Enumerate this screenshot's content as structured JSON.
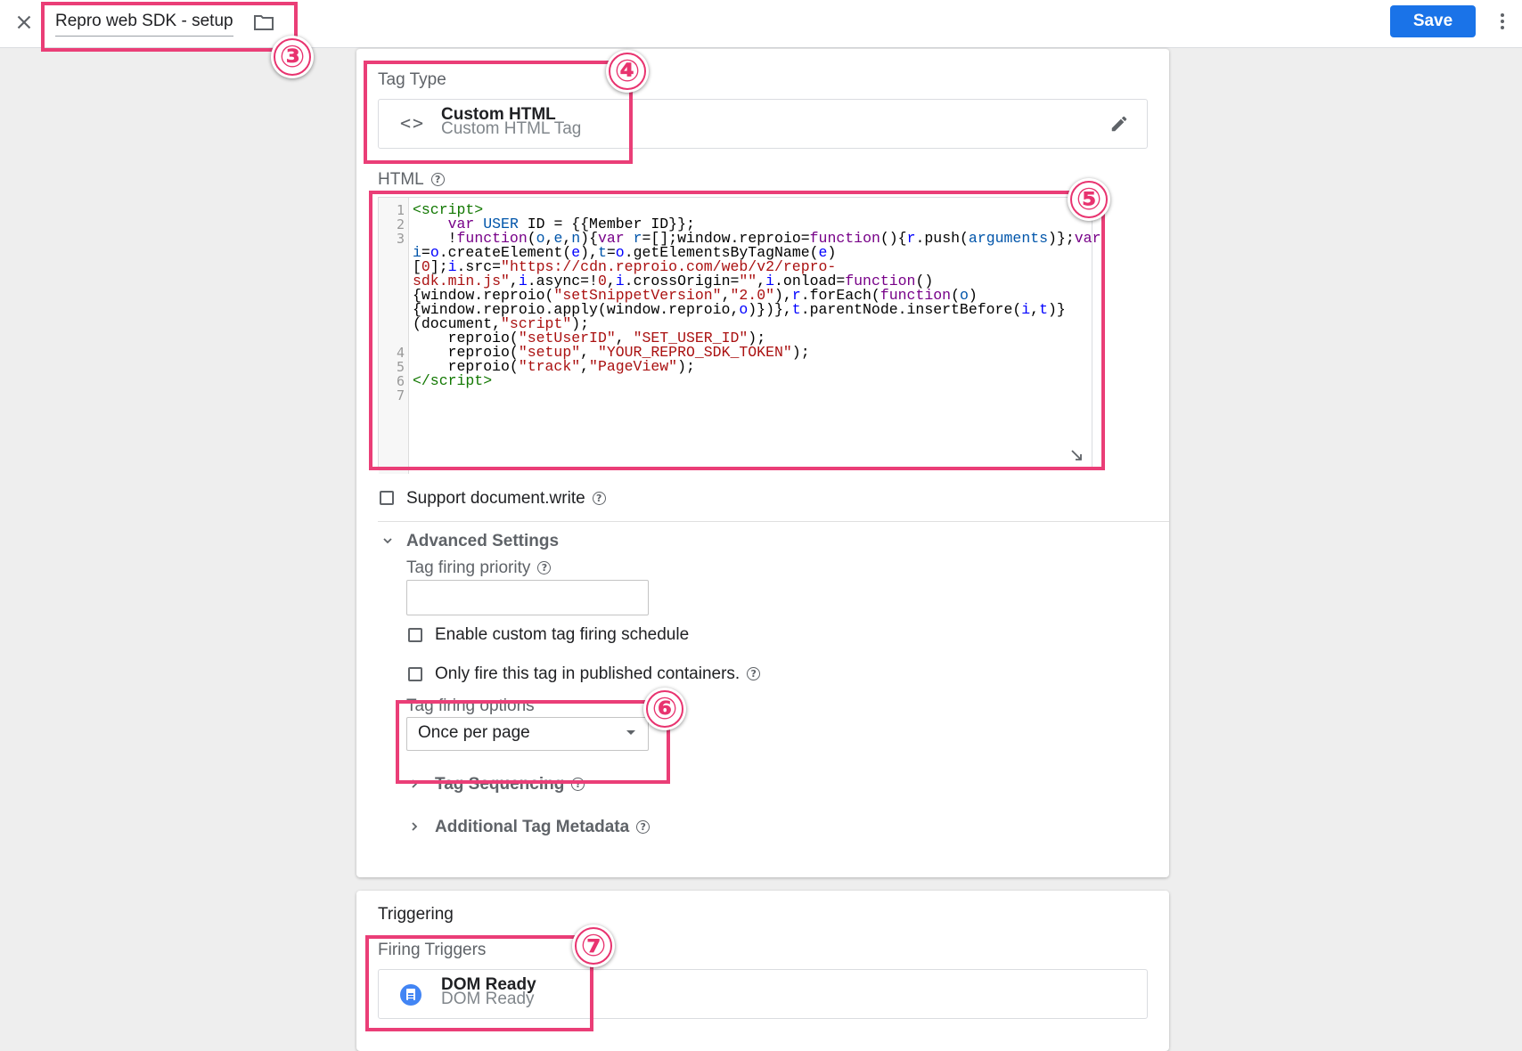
{
  "header": {
    "title": "Repro web SDK - setup",
    "save_label": "Save"
  },
  "tag_config": {
    "tag_type_label": "Tag Type",
    "tag_type_name": "Custom HTML",
    "tag_type_description": "Custom HTML Tag",
    "html_label": "HTML",
    "line_numbers": [
      "1",
      "2",
      "3",
      "",
      "",
      "",
      "",
      "",
      "",
      "",
      "4",
      "5",
      "6",
      "7"
    ],
    "support_document_write_label": "Support document.write"
  },
  "advanced": {
    "title": "Advanced Settings",
    "priority_label": "Tag firing priority",
    "priority_value": "",
    "enable_schedule_label": "Enable custom tag firing schedule",
    "published_only_label": "Only fire this tag in published containers.",
    "firing_options_label": "Tag firing options",
    "firing_option_selected": "Once per page",
    "tag_sequencing_label": "Tag Sequencing",
    "metadata_label": "Additional Tag Metadata"
  },
  "triggering": {
    "title": "Triggering",
    "firing_triggers_label": "Firing Triggers",
    "trigger_name": "DOM Ready",
    "trigger_type": "DOM Ready"
  },
  "annotations": [
    "③",
    "④",
    "⑤",
    "⑥",
    "⑦"
  ],
  "colors": {
    "annotation": "#ea3e77",
    "save_button": "#1a73e8",
    "trigger_icon": "#4285f4"
  }
}
